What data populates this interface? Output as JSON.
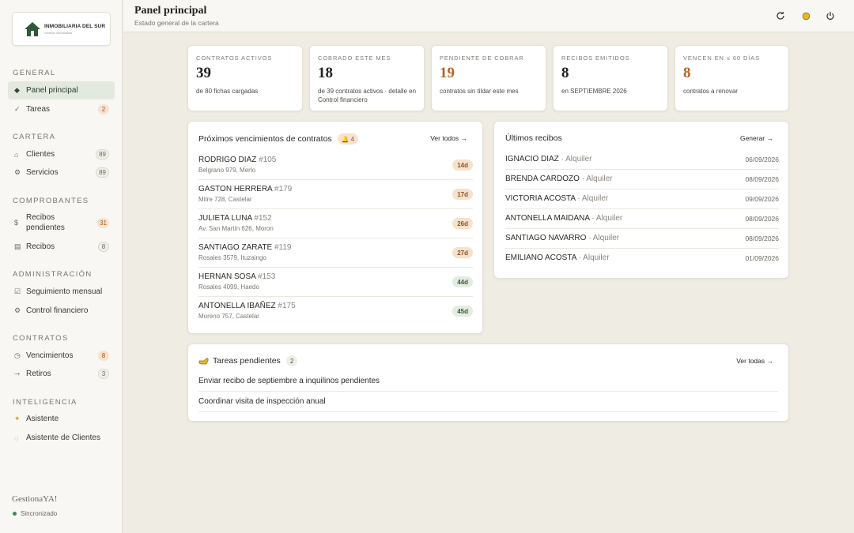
{
  "sidebar": {
    "logo": {
      "name": "INMOBILIARIA DEL SUR",
      "sub": "Gestión inmobiliaria"
    },
    "sections": {
      "general": "GENERAL",
      "cartera": "CARTERA",
      "comprobantes": "COMPROBANTES",
      "administracion": "ADMINISTRACIÓN",
      "contratos": "CONTRATOS",
      "inteligencia": "INTELIGENCIA"
    },
    "items": {
      "panel": {
        "label": "Panel principal"
      },
      "tareas": {
        "label": "Tareas",
        "badge": "2"
      },
      "clientes": {
        "label": "Clientes",
        "badge": "89"
      },
      "servicios": {
        "label": "Servicios",
        "badge": "89"
      },
      "recibos_pendientes": {
        "label": "Recibos pendientes",
        "badge": "31"
      },
      "recibos": {
        "label": "Recibos",
        "badge": "8"
      },
      "seguimiento": {
        "label": "Seguimiento mensual"
      },
      "control": {
        "label": "Control financiero"
      },
      "vencimientos": {
        "label": "Vencimientos",
        "badge": "8"
      },
      "retiros": {
        "label": "Retiros",
        "badge": "3"
      },
      "asistente": {
        "label": "Asistente"
      },
      "asistente_clientes": {
        "label": "Asistente de Clientes"
      }
    },
    "brand": "GestionaYA!",
    "sync_status": "Sincronizado"
  },
  "header": {
    "title": "Panel principal",
    "subtitle": "Estado general de la cartera"
  },
  "stats": [
    {
      "label": "CONTRATOS ACTIVOS",
      "value": "39",
      "desc": "de 80 fichas cargadas",
      "accent": false
    },
    {
      "label": "COBRADO ESTE MES",
      "value": "18",
      "desc": "de 39 contratos activos · detalle en Control financiero",
      "accent": false
    },
    {
      "label": "PENDIENTE DE COBRAR",
      "value": "19",
      "desc": "contratos sin tildar este mes",
      "accent": true
    },
    {
      "label": "RECIBOS EMITIDOS",
      "value": "8",
      "desc": "en SEPTIEMBRE 2026",
      "accent": false
    },
    {
      "label": "VENCEN EN ≤ 60 DÍAS",
      "value": "8",
      "desc": "contratos a renovar",
      "accent": true
    }
  ],
  "vencimientos": {
    "title": "Próximos vencimientos de contratos",
    "count": "4",
    "link": "Ver todos →",
    "rows": [
      {
        "name": "RODRIGO DIAZ",
        "num": "#105",
        "address": "Belgrano 979, Merlo",
        "days": "14d",
        "urgent": true
      },
      {
        "name": "GASTON HERRERA",
        "num": "#179",
        "address": "Mitre 728, Castelar",
        "days": "17d",
        "urgent": true
      },
      {
        "name": "JULIETA LUNA",
        "num": "#152",
        "address": "Av. San Martín 626, Moron",
        "days": "26d",
        "urgent": true
      },
      {
        "name": "SANTIAGO ZARATE",
        "num": "#119",
        "address": "Rosales 3579, Ituzaingo",
        "days": "27d",
        "urgent": true
      },
      {
        "name": "HERNAN SOSA",
        "num": "#153",
        "address": "Rosales 4099, Haedo",
        "days": "44d",
        "urgent": false
      },
      {
        "name": "ANTONELLA IBAÑEZ",
        "num": "#175",
        "address": "Moreno 757, Castelar",
        "days": "45d",
        "urgent": false
      }
    ]
  },
  "recibos": {
    "title": "Últimos recibos",
    "link": "Generar →",
    "rows": [
      {
        "name": "IGNACIO DIAZ",
        "type": "· Alquiler",
        "date": "06/09/2026"
      },
      {
        "name": "BRENDA CARDOZO",
        "type": "· Alquiler",
        "date": "08/09/2026"
      },
      {
        "name": "VICTORIA ACOSTA",
        "type": "· Alquiler",
        "date": "09/09/2026"
      },
      {
        "name": "ANTONELLA MAIDANA",
        "type": "· Alquiler",
        "date": "08/09/2026"
      },
      {
        "name": "SANTIAGO NAVARRO",
        "type": "· Alquiler",
        "date": "08/09/2026"
      },
      {
        "name": "EMILIANO ACOSTA",
        "type": "· Alquiler",
        "date": "01/09/2026"
      }
    ]
  },
  "tareas": {
    "title": "Tareas pendientes",
    "count": "2",
    "link": "Ver todas →",
    "rows": [
      {
        "text": "Enviar recibo de septiembre a inquilinos pendientes"
      },
      {
        "text": "Coordinar visita de inspección anual"
      }
    ]
  },
  "colors": {
    "accent_orange": "#b5622a",
    "active_green": "#e4e9e0",
    "brand_green": "#2f5a3a"
  }
}
